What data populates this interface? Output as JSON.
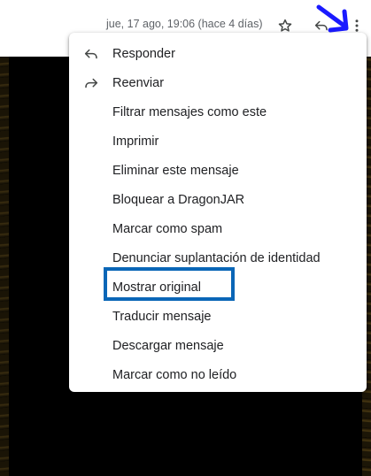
{
  "header": {
    "timestamp": "jue, 17 ago, 19:06 (hace 4 días)",
    "star_icon": "star-outline-icon",
    "reply_icon": "reply-icon",
    "more_icon": "more-vert-icon"
  },
  "menu": {
    "items": [
      {
        "label": "Responder",
        "icon": "reply-icon"
      },
      {
        "label": "Reenviar",
        "icon": "forward-icon"
      },
      {
        "label": "Filtrar mensajes como este"
      },
      {
        "label": "Imprimir"
      },
      {
        "label": "Eliminar este mensaje"
      },
      {
        "label": "Bloquear a DragonJAR"
      },
      {
        "label": "Marcar como spam"
      },
      {
        "label": "Denunciar suplantación de identidad"
      },
      {
        "label": "Mostrar original"
      },
      {
        "label": "Traducir mensaje"
      },
      {
        "label": "Descargar mensaje"
      },
      {
        "label": "Marcar como no leído"
      }
    ]
  },
  "annotations": {
    "arrow_color": "#1a1aff",
    "highlight_color": "#0a66b7"
  }
}
